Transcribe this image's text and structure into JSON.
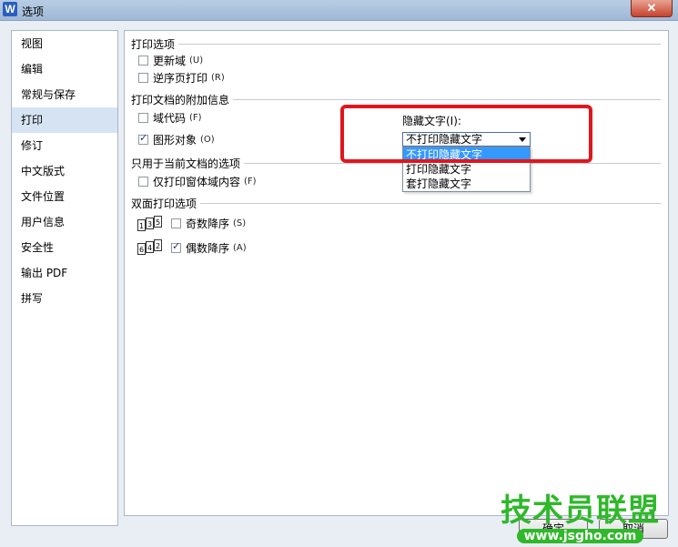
{
  "window": {
    "title": "选项",
    "app_icon_letter": "W",
    "close_glyph": "✕"
  },
  "nav": {
    "items": [
      "视图",
      "编辑",
      "常规与保存",
      "打印",
      "修订",
      "中文版式",
      "文件位置",
      "用户信息",
      "安全性",
      "输出 PDF",
      "拼写"
    ],
    "selected": "打印"
  },
  "print_options": {
    "title": "打印选项",
    "update_fields": {
      "label": "更新域",
      "hint": "(U)",
      "checked": false
    },
    "reverse_order": {
      "label": "逆序页打印",
      "hint": "(R)",
      "checked": false
    }
  },
  "extra_info": {
    "title": "打印文档的附加信息",
    "field_codes": {
      "label": "域代码",
      "hint": "(F)",
      "checked": false
    },
    "drawing_objects": {
      "label": "图形对象",
      "hint": "(O)",
      "checked": true
    },
    "hidden_text_label": "隐藏文字(I):",
    "hidden_text_value": "不打印隐藏文字",
    "hidden_text_options": [
      "不打印隐藏文字",
      "打印隐藏文字",
      "套打隐藏文字"
    ]
  },
  "current_doc": {
    "title": "只用于当前文档的选项",
    "form_data_only": {
      "label": "仅打印窗体域内容",
      "hint": "(F)",
      "checked": false
    }
  },
  "duplex": {
    "title": "双面打印选项",
    "odd_reverse": {
      "label": "奇数降序",
      "hint": "(S)",
      "checked": false,
      "icon_pages": [
        "1",
        "3",
        "5"
      ]
    },
    "even_reverse": {
      "label": "偶数降序",
      "hint": "(A)",
      "checked": true,
      "icon_pages": [
        "6",
        "4",
        "2"
      ]
    }
  },
  "buttons": {
    "ok": "确定",
    "cancel": "取消"
  },
  "watermark": {
    "big": "技术员联盟",
    "small": "www.jsgho.com"
  }
}
